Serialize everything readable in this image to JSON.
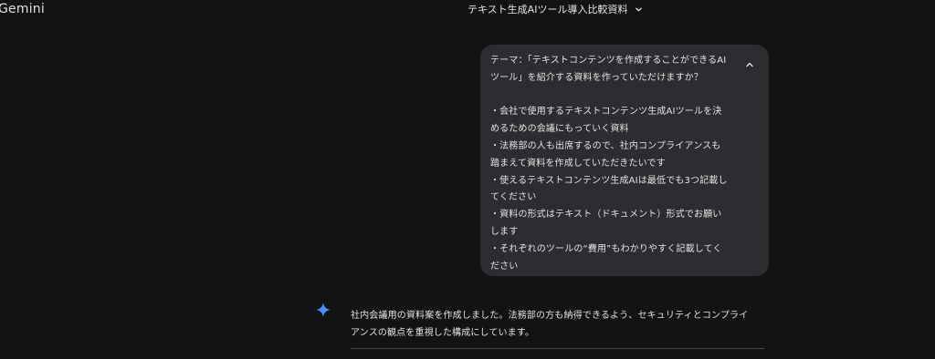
{
  "app": {
    "brand": "Gemini"
  },
  "conversation": {
    "title": "テキスト生成AIツール導入比較資料"
  },
  "user_message": {
    "text": "テーマ：「テキストコンテンツを作成することができるAI\nツール」を紹介する資料を作っていただけますか？\n\n・会社で使用するテキストコンテンツ生成AIツールを決\nめるための会議にもっていく資料\n・法務部の人も出席するので、社内コンプライアンスも\n踏まえて資料を作成していただきたいです\n・使えるテキストコンテンツ生成AIは最低でも3つ記載し\nてください\n・資料の形式はテキスト（ドキュメント）形式でお願い\nします\n・それぞれのツールの“費用”もわかりやすく記載してく\nださい"
  },
  "model_response": {
    "text": "社内会議用の資料案を作成しました。法務部の方も納得できるよう、セキュリティとコンプライ\nアンスの観点を重視した構成にしています。"
  },
  "icons": {
    "title_dropdown": "chevron-down-icon",
    "collapse": "chevron-up-icon",
    "model_avatar": "gemini-sparkle-icon"
  },
  "colors": {
    "background": "#131314",
    "bubble": "#2c2d30",
    "text": "#e3e3e3",
    "sparkle": "#4a8ff7"
  }
}
